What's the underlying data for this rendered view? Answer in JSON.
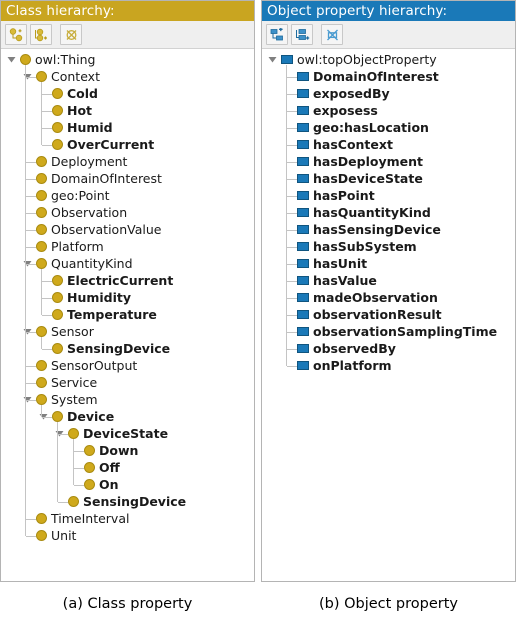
{
  "figure": {
    "caption_a": "(a) Class property",
    "caption_b": "(b) Object property"
  },
  "colors": {
    "class_header_bg": "#c9a520",
    "object_header_bg": "#1a79b8",
    "class_node": "#cfa91c",
    "object_node": "#1a79b8",
    "panel_border": "#b4b4b4",
    "toolbar_bg": "#efefef",
    "tree_line": "#c4c4c4",
    "text": "#1a1a1a"
  },
  "class_panel": {
    "header": "Class hierarchy:",
    "toolbar": [
      {
        "name": "add-subclass-icon",
        "tooltip": "Add subclass"
      },
      {
        "name": "add-sibling-class-icon",
        "tooltip": "Add sibling class"
      },
      {
        "name": "delete-class-icon",
        "tooltip": "Delete class"
      }
    ],
    "tree": [
      {
        "label": "owl:Thing",
        "depth": 0,
        "bold": false,
        "expanded": true,
        "icon": "class-node-icon"
      },
      {
        "label": "Context",
        "depth": 1,
        "bold": false,
        "expanded": true,
        "icon": "class-node-icon"
      },
      {
        "label": "Cold",
        "depth": 2,
        "bold": true,
        "expanded": null,
        "icon": "class-node-icon"
      },
      {
        "label": "Hot",
        "depth": 2,
        "bold": true,
        "expanded": null,
        "icon": "class-node-icon"
      },
      {
        "label": "Humid",
        "depth": 2,
        "bold": true,
        "expanded": null,
        "icon": "class-node-icon"
      },
      {
        "label": "OverCurrent",
        "depth": 2,
        "bold": true,
        "expanded": null,
        "icon": "class-node-icon"
      },
      {
        "label": "Deployment",
        "depth": 1,
        "bold": false,
        "expanded": null,
        "icon": "class-node-icon"
      },
      {
        "label": "DomainOfInterest",
        "depth": 1,
        "bold": false,
        "expanded": null,
        "icon": "class-node-icon"
      },
      {
        "label": "geo:Point",
        "depth": 1,
        "bold": false,
        "expanded": null,
        "icon": "class-node-icon"
      },
      {
        "label": "Observation",
        "depth": 1,
        "bold": false,
        "expanded": null,
        "icon": "class-node-icon"
      },
      {
        "label": "ObservationValue",
        "depth": 1,
        "bold": false,
        "expanded": null,
        "icon": "class-node-icon"
      },
      {
        "label": "Platform",
        "depth": 1,
        "bold": false,
        "expanded": null,
        "icon": "class-node-icon"
      },
      {
        "label": "QuantityKind",
        "depth": 1,
        "bold": false,
        "expanded": true,
        "icon": "class-node-icon"
      },
      {
        "label": "ElectricCurrent",
        "depth": 2,
        "bold": true,
        "expanded": null,
        "icon": "class-node-icon"
      },
      {
        "label": "Humidity",
        "depth": 2,
        "bold": true,
        "expanded": null,
        "icon": "class-node-icon"
      },
      {
        "label": "Temperature",
        "depth": 2,
        "bold": true,
        "expanded": null,
        "icon": "class-node-icon"
      },
      {
        "label": "Sensor",
        "depth": 1,
        "bold": false,
        "expanded": true,
        "icon": "class-node-icon"
      },
      {
        "label": "SensingDevice",
        "depth": 2,
        "bold": true,
        "expanded": null,
        "icon": "class-node-icon"
      },
      {
        "label": "SensorOutput",
        "depth": 1,
        "bold": false,
        "expanded": null,
        "icon": "class-node-icon"
      },
      {
        "label": "Service",
        "depth": 1,
        "bold": false,
        "expanded": null,
        "icon": "class-node-icon"
      },
      {
        "label": "System",
        "depth": 1,
        "bold": false,
        "expanded": true,
        "icon": "class-node-icon"
      },
      {
        "label": "Device",
        "depth": 2,
        "bold": true,
        "expanded": true,
        "icon": "class-node-icon"
      },
      {
        "label": "DeviceState",
        "depth": 3,
        "bold": true,
        "expanded": true,
        "icon": "class-node-icon"
      },
      {
        "label": "Down",
        "depth": 4,
        "bold": true,
        "expanded": null,
        "icon": "class-node-icon"
      },
      {
        "label": "Off",
        "depth": 4,
        "bold": true,
        "expanded": null,
        "icon": "class-node-icon"
      },
      {
        "label": "On",
        "depth": 4,
        "bold": true,
        "expanded": null,
        "icon": "class-node-icon"
      },
      {
        "label": "SensingDevice",
        "depth": 3,
        "bold": true,
        "expanded": null,
        "icon": "class-node-icon"
      },
      {
        "label": "TimeInterval",
        "depth": 1,
        "bold": false,
        "expanded": null,
        "icon": "class-node-icon"
      },
      {
        "label": "Unit",
        "depth": 1,
        "bold": false,
        "expanded": null,
        "icon": "class-node-icon"
      }
    ]
  },
  "object_panel": {
    "header": "Object property hierarchy:",
    "toolbar": [
      {
        "name": "add-subproperty-icon",
        "tooltip": "Add sub property"
      },
      {
        "name": "add-sibling-property-icon",
        "tooltip": "Add sibling property"
      },
      {
        "name": "delete-property-icon",
        "tooltip": "Delete property"
      }
    ],
    "tree": [
      {
        "label": "owl:topObjectProperty",
        "depth": 0,
        "bold": false,
        "expanded": true,
        "icon": "object-property-icon"
      },
      {
        "label": "DomainOfInterest",
        "depth": 1,
        "bold": true,
        "expanded": null,
        "icon": "object-property-icon"
      },
      {
        "label": "exposedBy",
        "depth": 1,
        "bold": true,
        "expanded": null,
        "icon": "object-property-icon"
      },
      {
        "label": "exposess",
        "depth": 1,
        "bold": true,
        "expanded": null,
        "icon": "object-property-icon"
      },
      {
        "label": "geo:hasLocation",
        "depth": 1,
        "bold": true,
        "expanded": null,
        "icon": "object-property-icon"
      },
      {
        "label": "hasContext",
        "depth": 1,
        "bold": true,
        "expanded": null,
        "icon": "object-property-icon"
      },
      {
        "label": "hasDeployment",
        "depth": 1,
        "bold": true,
        "expanded": null,
        "icon": "object-property-icon"
      },
      {
        "label": "hasDeviceState",
        "depth": 1,
        "bold": true,
        "expanded": null,
        "icon": "object-property-icon"
      },
      {
        "label": "hasPoint",
        "depth": 1,
        "bold": true,
        "expanded": null,
        "icon": "object-property-icon"
      },
      {
        "label": "hasQuantityKind",
        "depth": 1,
        "bold": true,
        "expanded": null,
        "icon": "object-property-icon"
      },
      {
        "label": "hasSensingDevice",
        "depth": 1,
        "bold": true,
        "expanded": null,
        "icon": "object-property-icon"
      },
      {
        "label": "hasSubSystem",
        "depth": 1,
        "bold": true,
        "expanded": null,
        "icon": "object-property-icon"
      },
      {
        "label": "hasUnit",
        "depth": 1,
        "bold": true,
        "expanded": null,
        "icon": "object-property-icon"
      },
      {
        "label": "hasValue",
        "depth": 1,
        "bold": true,
        "expanded": null,
        "icon": "object-property-icon"
      },
      {
        "label": "madeObservation",
        "depth": 1,
        "bold": true,
        "expanded": null,
        "icon": "object-property-icon"
      },
      {
        "label": "observationResult",
        "depth": 1,
        "bold": true,
        "expanded": null,
        "icon": "object-property-icon"
      },
      {
        "label": "observationSamplingTime",
        "depth": 1,
        "bold": true,
        "expanded": null,
        "icon": "object-property-icon"
      },
      {
        "label": "observedBy",
        "depth": 1,
        "bold": true,
        "expanded": null,
        "icon": "object-property-icon"
      },
      {
        "label": "onPlatform",
        "depth": 1,
        "bold": true,
        "expanded": null,
        "icon": "object-property-icon"
      }
    ]
  }
}
